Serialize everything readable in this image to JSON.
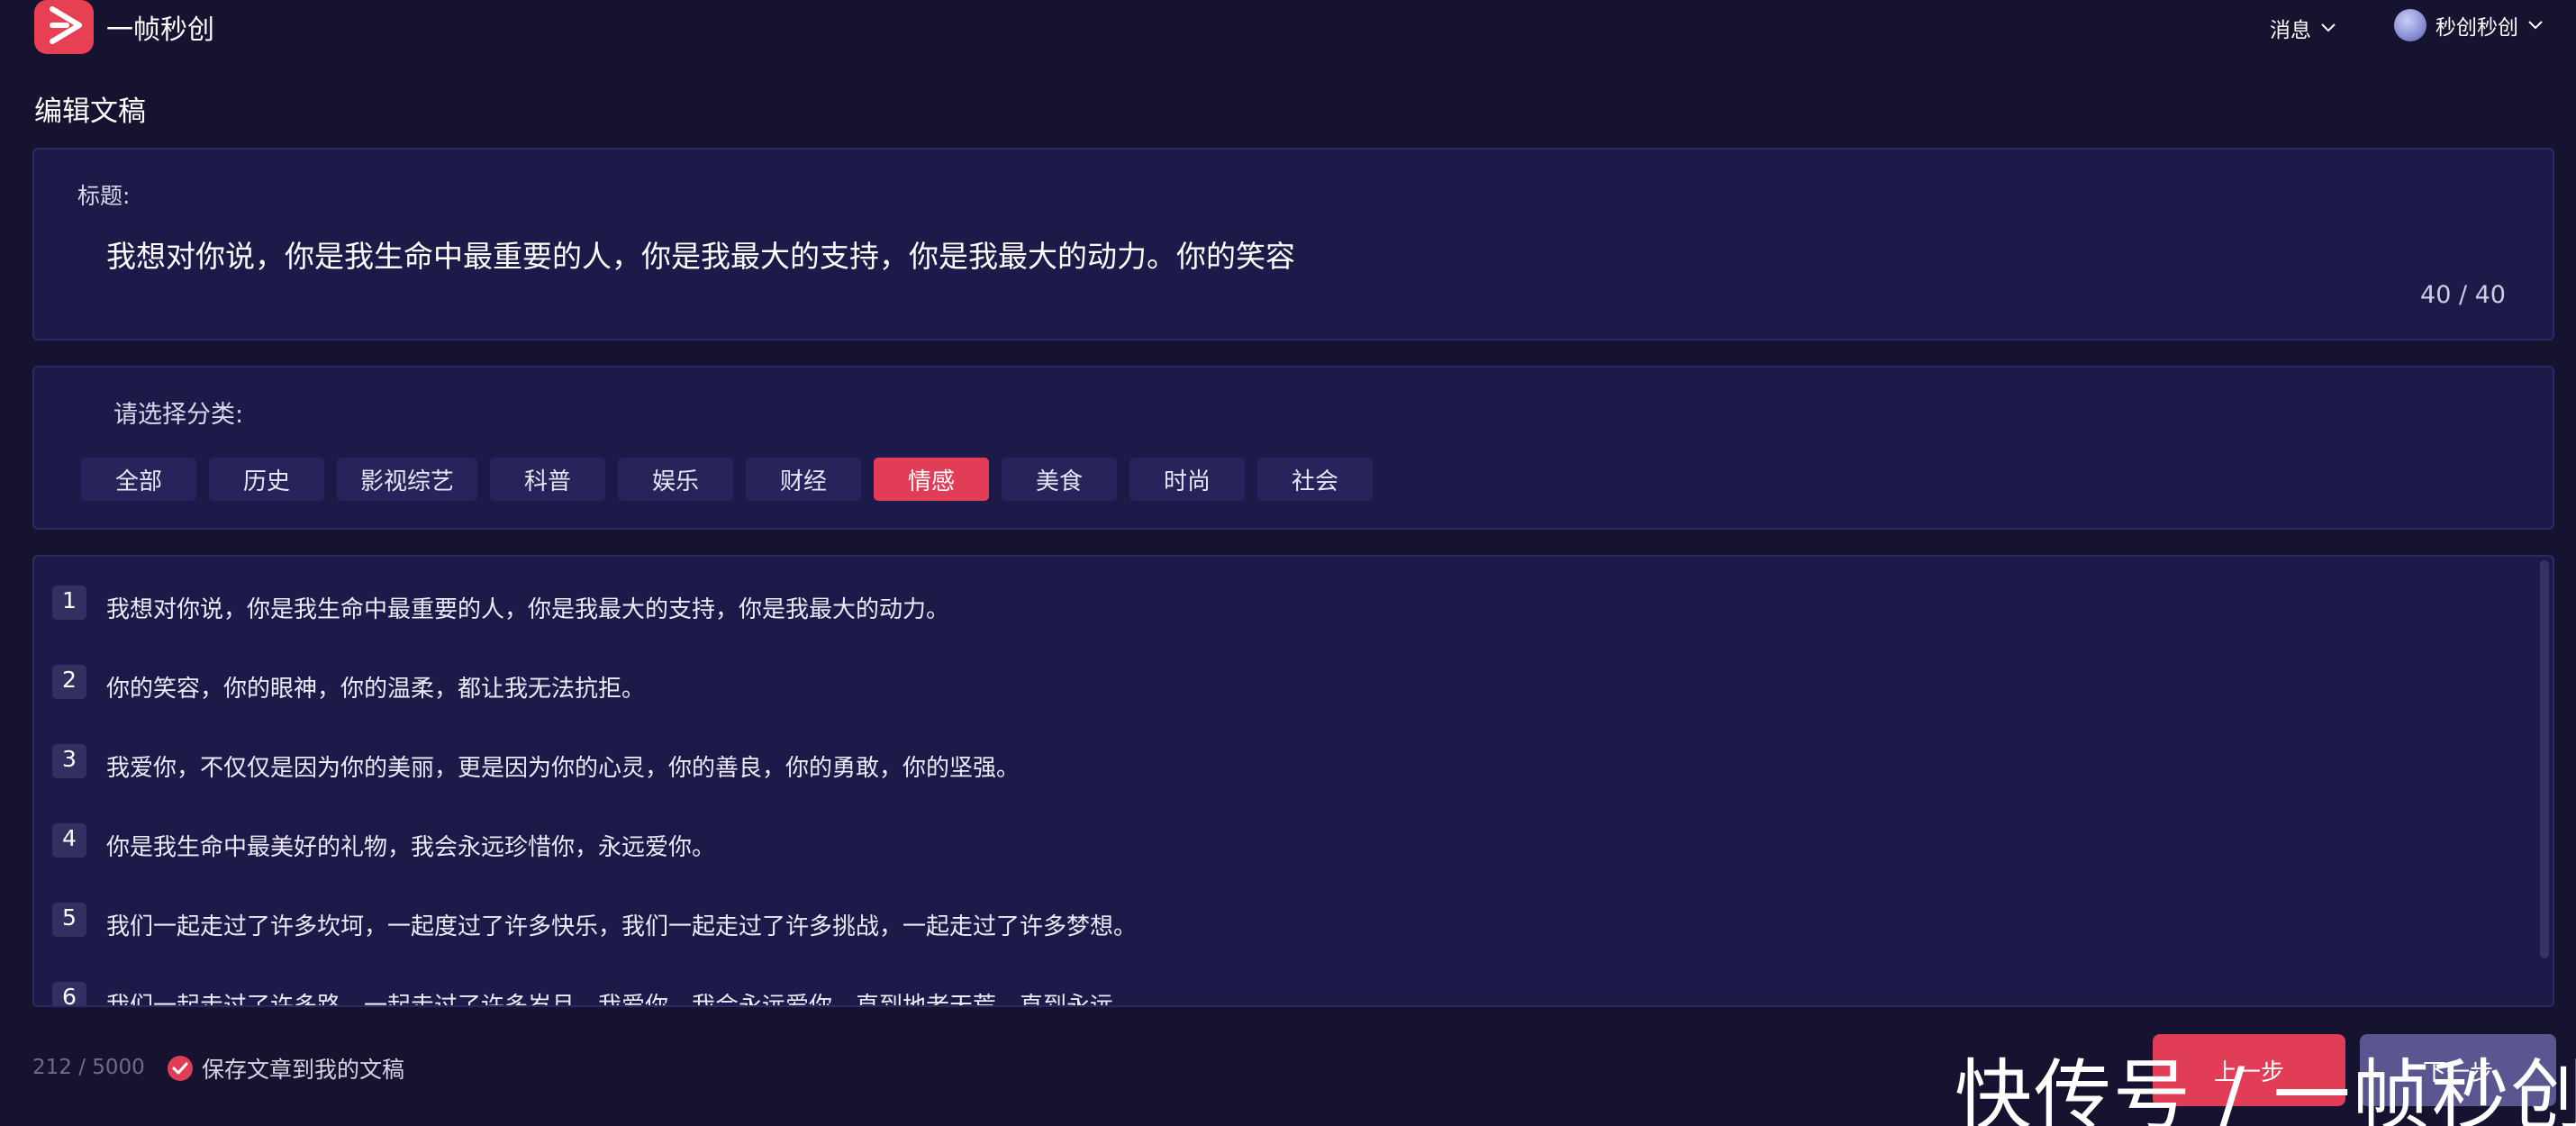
{
  "header": {
    "app_name": "一帧秒创",
    "messages_label": "消息",
    "user_name": "秒创秒创"
  },
  "page_title": "编辑文稿",
  "title_section": {
    "label": "标题:",
    "value": "我想对你说，你是我生命中最重要的人，你是我最大的支持，你是我最大的动力。你的笑容",
    "counter": "40 / 40"
  },
  "category_section": {
    "label": "请选择分类:",
    "categories": [
      "全部",
      "历史",
      "影视综艺",
      "科普",
      "娱乐",
      "财经",
      "情感",
      "美食",
      "时尚",
      "社会"
    ],
    "selected": "情感"
  },
  "content": {
    "lines": [
      {
        "num": "1",
        "text": "我想对你说，你是我生命中最重要的人，你是我最大的支持，你是我最大的动力。"
      },
      {
        "num": "2",
        "text": "你的笑容，你的眼神，你的温柔，都让我无法抗拒。"
      },
      {
        "num": "3",
        "text": "我爱你，不仅仅是因为你的美丽，更是因为你的心灵，你的善良，你的勇敢，你的坚强。"
      },
      {
        "num": "4",
        "text": "你是我生命中最美好的礼物，我会永远珍惜你，永远爱你。"
      },
      {
        "num": "5",
        "text": "我们一起走过了许多坎坷，一起度过了许多快乐，我们一起走过了许多挑战，一起走过了许多梦想。"
      },
      {
        "num": "6",
        "text": "我们一起走过了许多路，一起走过了许多岁月，我爱你，我会永远爱你，直到地老天荒，直到永远。"
      }
    ]
  },
  "footer": {
    "word_count": "212 / 5000",
    "save_label": "保存文章到我的文稿",
    "prev_label": "上一步",
    "next_label": "下一步"
  },
  "watermark": "快传号 / 一帧秒创",
  "colors": {
    "background": "#15132f",
    "panel": "#1c1a48",
    "accent": "#e23d57",
    "chip": "#26245a"
  },
  "icons": [
    "play-logo-icon",
    "chevron-down-icon",
    "avatar",
    "check-icon"
  ]
}
